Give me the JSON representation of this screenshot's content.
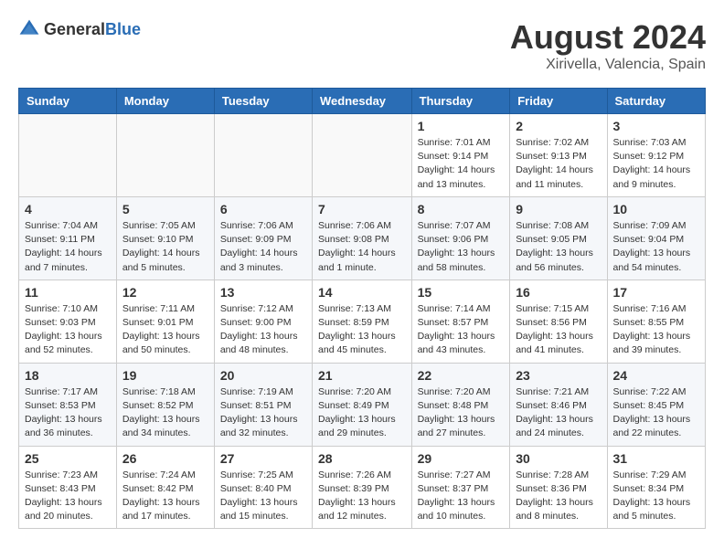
{
  "header": {
    "logo_general": "General",
    "logo_blue": "Blue",
    "month": "August 2024",
    "location": "Xirivella, Valencia, Spain"
  },
  "weekdays": [
    "Sunday",
    "Monday",
    "Tuesday",
    "Wednesday",
    "Thursday",
    "Friday",
    "Saturday"
  ],
  "weeks": [
    [
      {
        "day": "",
        "info": ""
      },
      {
        "day": "",
        "info": ""
      },
      {
        "day": "",
        "info": ""
      },
      {
        "day": "",
        "info": ""
      },
      {
        "day": "1",
        "info": "Sunrise: 7:01 AM\nSunset: 9:14 PM\nDaylight: 14 hours\nand 13 minutes."
      },
      {
        "day": "2",
        "info": "Sunrise: 7:02 AM\nSunset: 9:13 PM\nDaylight: 14 hours\nand 11 minutes."
      },
      {
        "day": "3",
        "info": "Sunrise: 7:03 AM\nSunset: 9:12 PM\nDaylight: 14 hours\nand 9 minutes."
      }
    ],
    [
      {
        "day": "4",
        "info": "Sunrise: 7:04 AM\nSunset: 9:11 PM\nDaylight: 14 hours\nand 7 minutes."
      },
      {
        "day": "5",
        "info": "Sunrise: 7:05 AM\nSunset: 9:10 PM\nDaylight: 14 hours\nand 5 minutes."
      },
      {
        "day": "6",
        "info": "Sunrise: 7:06 AM\nSunset: 9:09 PM\nDaylight: 14 hours\nand 3 minutes."
      },
      {
        "day": "7",
        "info": "Sunrise: 7:06 AM\nSunset: 9:08 PM\nDaylight: 14 hours\nand 1 minute."
      },
      {
        "day": "8",
        "info": "Sunrise: 7:07 AM\nSunset: 9:06 PM\nDaylight: 13 hours\nand 58 minutes."
      },
      {
        "day": "9",
        "info": "Sunrise: 7:08 AM\nSunset: 9:05 PM\nDaylight: 13 hours\nand 56 minutes."
      },
      {
        "day": "10",
        "info": "Sunrise: 7:09 AM\nSunset: 9:04 PM\nDaylight: 13 hours\nand 54 minutes."
      }
    ],
    [
      {
        "day": "11",
        "info": "Sunrise: 7:10 AM\nSunset: 9:03 PM\nDaylight: 13 hours\nand 52 minutes."
      },
      {
        "day": "12",
        "info": "Sunrise: 7:11 AM\nSunset: 9:01 PM\nDaylight: 13 hours\nand 50 minutes."
      },
      {
        "day": "13",
        "info": "Sunrise: 7:12 AM\nSunset: 9:00 PM\nDaylight: 13 hours\nand 48 minutes."
      },
      {
        "day": "14",
        "info": "Sunrise: 7:13 AM\nSunset: 8:59 PM\nDaylight: 13 hours\nand 45 minutes."
      },
      {
        "day": "15",
        "info": "Sunrise: 7:14 AM\nSunset: 8:57 PM\nDaylight: 13 hours\nand 43 minutes."
      },
      {
        "day": "16",
        "info": "Sunrise: 7:15 AM\nSunset: 8:56 PM\nDaylight: 13 hours\nand 41 minutes."
      },
      {
        "day": "17",
        "info": "Sunrise: 7:16 AM\nSunset: 8:55 PM\nDaylight: 13 hours\nand 39 minutes."
      }
    ],
    [
      {
        "day": "18",
        "info": "Sunrise: 7:17 AM\nSunset: 8:53 PM\nDaylight: 13 hours\nand 36 minutes."
      },
      {
        "day": "19",
        "info": "Sunrise: 7:18 AM\nSunset: 8:52 PM\nDaylight: 13 hours\nand 34 minutes."
      },
      {
        "day": "20",
        "info": "Sunrise: 7:19 AM\nSunset: 8:51 PM\nDaylight: 13 hours\nand 32 minutes."
      },
      {
        "day": "21",
        "info": "Sunrise: 7:20 AM\nSunset: 8:49 PM\nDaylight: 13 hours\nand 29 minutes."
      },
      {
        "day": "22",
        "info": "Sunrise: 7:20 AM\nSunset: 8:48 PM\nDaylight: 13 hours\nand 27 minutes."
      },
      {
        "day": "23",
        "info": "Sunrise: 7:21 AM\nSunset: 8:46 PM\nDaylight: 13 hours\nand 24 minutes."
      },
      {
        "day": "24",
        "info": "Sunrise: 7:22 AM\nSunset: 8:45 PM\nDaylight: 13 hours\nand 22 minutes."
      }
    ],
    [
      {
        "day": "25",
        "info": "Sunrise: 7:23 AM\nSunset: 8:43 PM\nDaylight: 13 hours\nand 20 minutes."
      },
      {
        "day": "26",
        "info": "Sunrise: 7:24 AM\nSunset: 8:42 PM\nDaylight: 13 hours\nand 17 minutes."
      },
      {
        "day": "27",
        "info": "Sunrise: 7:25 AM\nSunset: 8:40 PM\nDaylight: 13 hours\nand 15 minutes."
      },
      {
        "day": "28",
        "info": "Sunrise: 7:26 AM\nSunset: 8:39 PM\nDaylight: 13 hours\nand 12 minutes."
      },
      {
        "day": "29",
        "info": "Sunrise: 7:27 AM\nSunset: 8:37 PM\nDaylight: 13 hours\nand 10 minutes."
      },
      {
        "day": "30",
        "info": "Sunrise: 7:28 AM\nSunset: 8:36 PM\nDaylight: 13 hours\nand 8 minutes."
      },
      {
        "day": "31",
        "info": "Sunrise: 7:29 AM\nSunset: 8:34 PM\nDaylight: 13 hours\nand 5 minutes."
      }
    ]
  ]
}
